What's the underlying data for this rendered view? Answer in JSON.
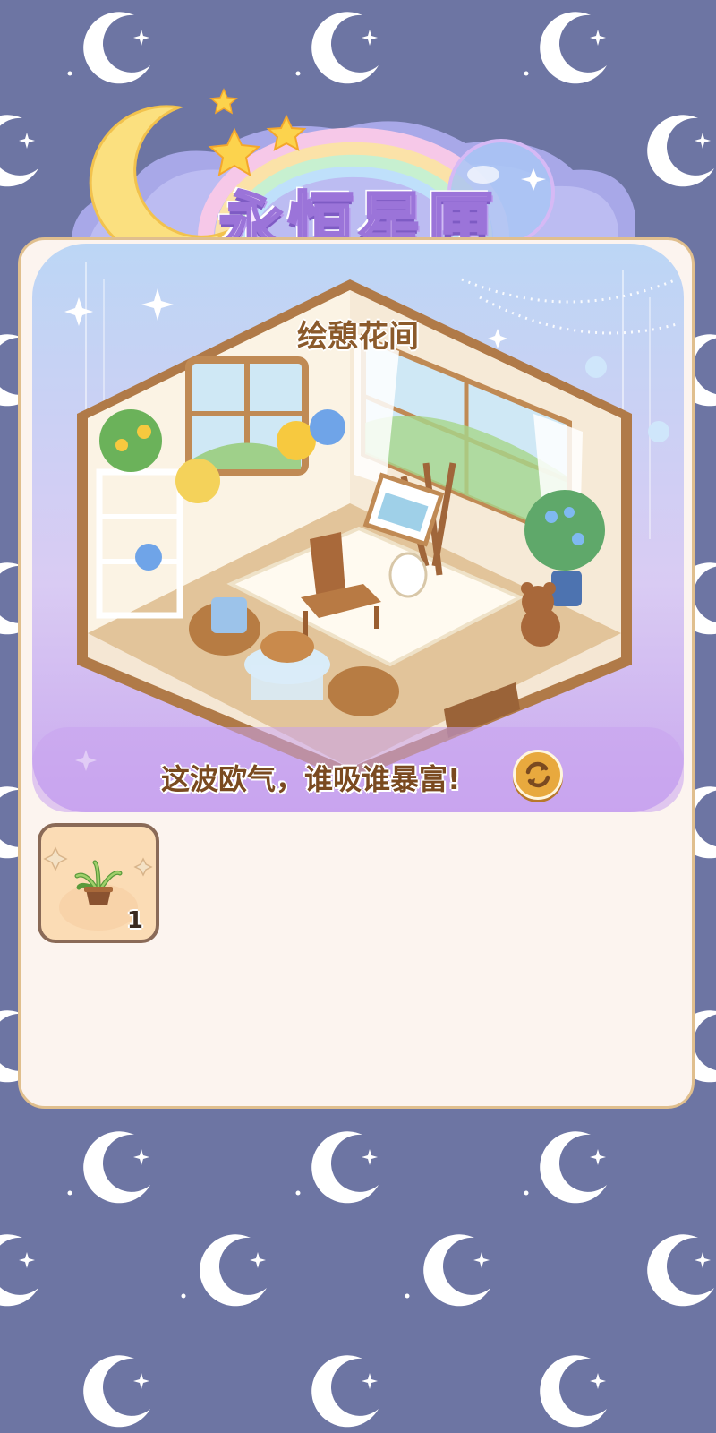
{
  "header": {
    "title": "永恒星匣"
  },
  "scene": {
    "room_name": "绘憩花间",
    "slogan": "这波欧气，谁吸谁暴富!",
    "refresh_icon": "refresh-icon"
  },
  "inventory": {
    "items": [
      {
        "icon": "potted-plant-icon",
        "count": "1"
      }
    ]
  },
  "colors": {
    "background": "#6d75a3",
    "card": "#fcf4ef",
    "card_border": "#e0bf8e",
    "accent_gold": "#e8a93e",
    "title_purple": "#9b74d9"
  }
}
